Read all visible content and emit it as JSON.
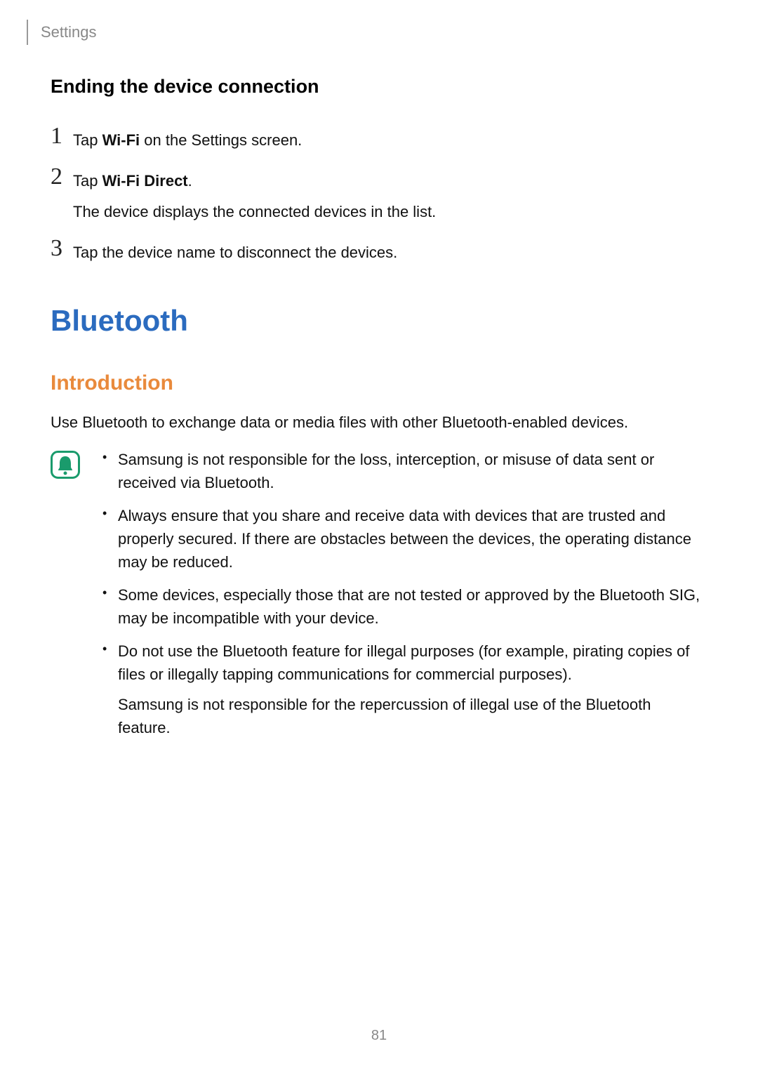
{
  "header": {
    "crumb": "Settings"
  },
  "section1": {
    "heading": "Ending the device connection",
    "steps": [
      {
        "num": "1",
        "pre": "Tap ",
        "bold": "Wi-Fi",
        "post": " on the Settings screen."
      },
      {
        "num": "2",
        "pre": "Tap ",
        "bold": "Wi-Fi Direct",
        "post": ".",
        "sub": "The device displays the connected devices in the list."
      },
      {
        "num": "3",
        "pre": "Tap the device name to disconnect the devices.",
        "bold": "",
        "post": ""
      }
    ]
  },
  "section2": {
    "h1": "Bluetooth",
    "h2": "Introduction",
    "intro": "Use Bluetooth to exchange data or media files with other Bluetooth-enabled devices.",
    "notices": [
      {
        "text": "Samsung is not responsible for the loss, interception, or misuse of data sent or received via Bluetooth."
      },
      {
        "text": "Always ensure that you share and receive data with devices that are trusted and properly secured. If there are obstacles between the devices, the operating distance may be reduced."
      },
      {
        "text": "Some devices, especially those that are not tested or approved by the Bluetooth SIG, may be incompatible with your device."
      },
      {
        "text": "Do not use the Bluetooth feature for illegal purposes (for example, pirating copies of files or illegally tapping communications for commercial purposes).",
        "extra": "Samsung is not responsible for the repercussion of illegal use of the Bluetooth feature."
      }
    ]
  },
  "page": "81"
}
